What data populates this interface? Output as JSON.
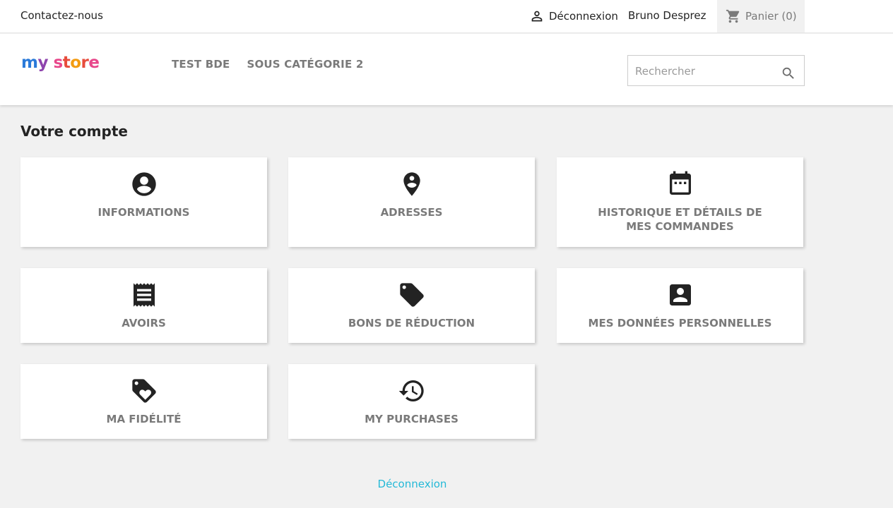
{
  "topbar": {
    "contact": "Contactez-nous",
    "logout": "Déconnexion",
    "username": "Bruno Desprez",
    "cart": "Panier (0)"
  },
  "header": {
    "logo": "my store",
    "nav": [
      "TEST BDE",
      "SOUS CATÉGORIE 2"
    ],
    "search_placeholder": "Rechercher"
  },
  "main": {
    "title": "Votre compte",
    "cards": [
      {
        "label": "INFORMATIONS",
        "icon": "account-circle-icon"
      },
      {
        "label": "ADRESSES",
        "icon": "location-pin-icon"
      },
      {
        "label": "HISTORIQUE ET DÉTAILS DE MES COMMANDES",
        "icon": "calendar-icon"
      },
      {
        "label": "AVOIRS",
        "icon": "receipt-icon"
      },
      {
        "label": "BONS DE RÉDUCTION",
        "icon": "tag-icon"
      },
      {
        "label": "MES DONNÉES PERSONNELLES",
        "icon": "account-box-icon"
      },
      {
        "label": "MA FIDÉLITÉ",
        "icon": "loyalty-icon"
      },
      {
        "label": "MY PURCHASES",
        "icon": "history-icon"
      }
    ],
    "footer_logout": "Déconnexion"
  },
  "colors": {
    "background": "#f1f1f1",
    "text": "#232323",
    "muted": "#7a7a7a",
    "link": "#24b9d7"
  }
}
